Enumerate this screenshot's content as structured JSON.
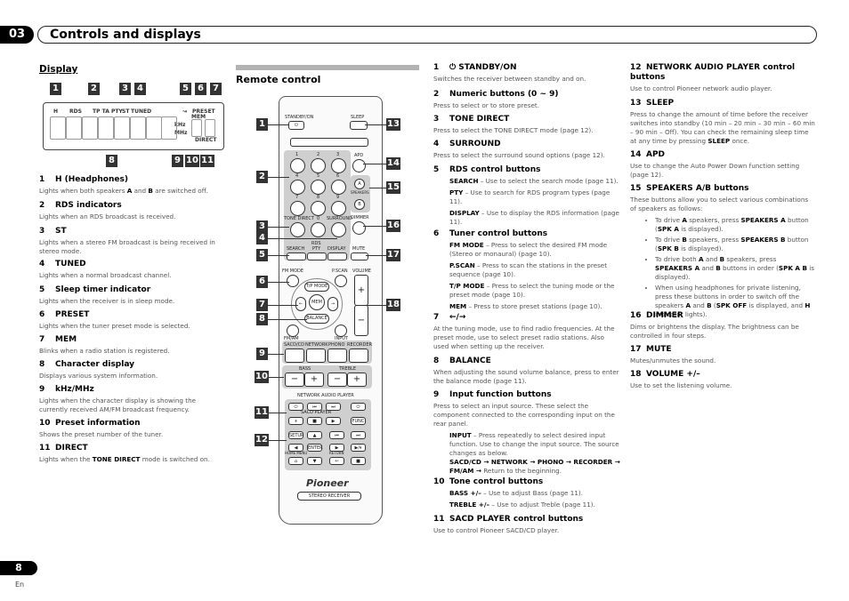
{
  "header": {
    "chapter_number": "03",
    "chapter_title": "Controls and displays"
  },
  "display_section": {
    "title": "Display",
    "diagram": {
      "badges": [
        "1",
        "2",
        "3",
        "4",
        "5",
        "6",
        "7",
        "8",
        "9",
        "10",
        "11"
      ],
      "labels": {
        "h": "H",
        "rds": "RDS",
        "tp": "TP TA PTY",
        "st": "ST",
        "tuned": "TUNED",
        "sleep": "↝",
        "preset": "PRESET",
        "mem": "MEM",
        "khz": "kHz",
        "mhz": "MHz",
        "direct": "DIRECT"
      }
    },
    "items": [
      {
        "num": "1",
        "title": "H (Headphones)",
        "text_parts": [
          "Lights when both speakers ",
          "A",
          " and ",
          "B",
          " are switched off."
        ]
      },
      {
        "num": "2",
        "title": "RDS indicators",
        "text": "Lights when an RDS broadcast is received."
      },
      {
        "num": "3",
        "title": "ST",
        "text": "Lights when a stereo FM broadcast is being received in stereo mode."
      },
      {
        "num": "4",
        "title": "TUNED",
        "text": "Lights when a normal broadcast channel."
      },
      {
        "num": "5",
        "title": "Sleep timer indicator",
        "text": "Lights when the receiver is in sleep mode."
      },
      {
        "num": "6",
        "title": "PRESET",
        "text": "Lights when the tuner preset mode is selected."
      },
      {
        "num": "7",
        "title": "MEM",
        "text": "Blinks when a radio station is registered."
      },
      {
        "num": "8",
        "title": "Character display",
        "text": "Displays various system information."
      },
      {
        "num": "9",
        "title": "kHz/MHz",
        "text": "Lights when the character display is showing the currently received AM/FM broadcast frequency."
      },
      {
        "num": "10",
        "title": "Preset information",
        "text": "Shows the preset number of the tuner."
      },
      {
        "num": "11",
        "title": "DIRECT",
        "text_parts": [
          "Lights when the ",
          "TONE DIRECT",
          " mode is switched on."
        ]
      }
    ]
  },
  "remote_section": {
    "title": "Remote control",
    "badges": [
      "1",
      "2",
      "3",
      "4",
      "5",
      "6",
      "7",
      "8",
      "9",
      "10",
      "11",
      "12",
      "13",
      "14",
      "15",
      "16",
      "17",
      "18"
    ],
    "labels": {
      "standby": "STANDBY/ON",
      "sleep": "SLEEP",
      "apd": "APD",
      "speakers": "SPEAKERS",
      "spk_a": "A",
      "spk_b": "B",
      "tone_direct": "TONE DIRECT",
      "zero": "0",
      "surround": "SURROUND",
      "dimmer": "DIMMER",
      "rds": "RDS",
      "search": "SEARCH",
      "pty": "PTY",
      "display": "DISPLAY",
      "mute": "MUTE",
      "fm_mode": "FM MODE",
      "pscan": "P.SCAN",
      "volume": "VOLUME",
      "tp_mode": "T/P MODE",
      "mem": "MEM",
      "balance": "BALANCE",
      "fm_am": "FM/AM",
      "input": "INPUT",
      "sacd": "SACD/CD",
      "network": "NETWORK",
      "phono": "PHONO",
      "recorder": "RECORDER",
      "bass": "BASS",
      "treble": "TREBLE",
      "minus": "−",
      "plus": "+",
      "nap": "NETWORK AUDIO PLAYER",
      "sacd_player": "SACD PLAYER",
      "func": "FUNC",
      "setup": "SETUP",
      "enter": "ENTER",
      "home_menu": "HOME MENU",
      "return": "RETURN",
      "brand": "Pioneer",
      "model": "STEREO RECEIVER",
      "digits": [
        "1",
        "2",
        "3",
        "4",
        "5",
        "6",
        "7",
        "8",
        "9"
      ]
    }
  },
  "col2_items": [
    {
      "num": "1",
      "title": "⏻ STANDBY/ON",
      "text": "Switches the receiver between standby and on."
    },
    {
      "num": "2",
      "title": "Numeric buttons (0 ~ 9)",
      "text": "Press to select or to store preset."
    },
    {
      "num": "3",
      "title": "TONE DIRECT",
      "text": "Press to select the TONE DIRECT mode (page 12)."
    },
    {
      "num": "4",
      "title": "SURROUND",
      "text": "Press to select the surround sound options (page 12)."
    },
    {
      "num": "5",
      "title": "RDS control buttons",
      "subs": [
        {
          "key": "SEARCH",
          "text": " – Use to select the search mode (page 11)."
        },
        {
          "key": "PTY",
          "text": " – Use to search for RDS program types (page 11)."
        },
        {
          "key": "DISPLAY",
          "text": " – Use to display the RDS information (page 11)."
        }
      ]
    },
    {
      "num": "6",
      "title": "Tuner control buttons",
      "subs": [
        {
          "key": "FM MODE",
          "text": " – Press to select the desired FM mode (Stereo or monaural) (page 10)."
        },
        {
          "key": "P.SCAN",
          "text": " – Press to scan the stations in the preset sequence (page 10)."
        },
        {
          "key": "T/P MODE",
          "text": " – Press to select the tuning mode or the preset mode (page 10)."
        },
        {
          "key": "MEM",
          "text": " – Press to store preset stations (page 10)."
        }
      ]
    },
    {
      "num": "7",
      "title": "←/→",
      "text": "At the tuning mode, use to find radio frequencies. At the preset mode, use to select preset radio stations. Also used when setting up the receiver."
    },
    {
      "num": "8",
      "title": "BALANCE",
      "text": "When adjusting the sound volume balance, press to enter the balance mode (page 11)."
    },
    {
      "num": "9",
      "title": "Input function buttons",
      "text": "Press to select an input source. These select the component connected to the corresponding input on the rear panel.",
      "subs": [
        {
          "key": "INPUT",
          "text": " – Press repeatedly to select desired input function. Use to change the input source. The source changes as below."
        }
      ],
      "chain": "SACD/CD → NETWORK → PHONO → RECORDER → FM/AM →",
      "chain_end": " Return to the beginning."
    },
    {
      "num": "10",
      "title": "Tone control buttons",
      "subs": [
        {
          "key": "BASS +/–",
          "text": " – Use to adjust Bass (page 11)."
        },
        {
          "key": "TREBLE +/–",
          "text": " – Use to adjust Treble (page 11)."
        }
      ]
    },
    {
      "num": "11",
      "title": "SACD PLAYER control buttons",
      "text": "Use to control Pioneer SACD/CD player."
    }
  ],
  "col3_items": [
    {
      "num": "12",
      "title": "NETWORK AUDIO PLAYER control buttons",
      "text": "Use to control Pioneer network audio player."
    },
    {
      "num": "13",
      "title": "SLEEP",
      "text_parts": [
        "Press to change the amount of time before the receiver switches into standby (10 min – 20 min – 30 min – 60 min – 90 min – Off). You can check the remaining sleep time at any time by pressing ",
        "SLEEP",
        " once."
      ]
    },
    {
      "num": "14",
      "title": "APD",
      "text": "Use to change the Auto Power Down function setting (page 12)."
    },
    {
      "num": "15",
      "title": "SPEAKERS A/B buttons",
      "text": "These buttons allow you to select various combinations of speakers as follows:",
      "bullets": [
        "To drive <b>A</b> speakers, press <b>SPEAKERS A</b> button (<b>SPK A</b> is displayed).",
        "To drive <b>B</b> speakers, press <b>SPEAKERS B</b> button (<b>SPK B</b> is displayed).",
        "To drive both <b>A</b> and <b>B</b> speakers, press <b>SPEAKERS A</b> and <b>B</b> buttons in order (<b>SPK A B</b> is displayed).",
        "When using headphones for private listening, press these buttons in order to switch off the speakers <b>A</b> and <b>B</b> (<b>SPK OFF</b> is displayed, and <b>H</b> indicator lights)."
      ]
    },
    {
      "num": "16",
      "title": "DIMMER",
      "text": "Dims or brightens the display. The brightness can be controlled in four steps."
    },
    {
      "num": "17",
      "title": "MUTE",
      "text": "Mutes/unmutes the sound."
    },
    {
      "num": "18",
      "title": "VOLUME +/–",
      "text": "Use to set the listening volume."
    }
  ],
  "footer": {
    "page_number": "8",
    "language": "En"
  }
}
